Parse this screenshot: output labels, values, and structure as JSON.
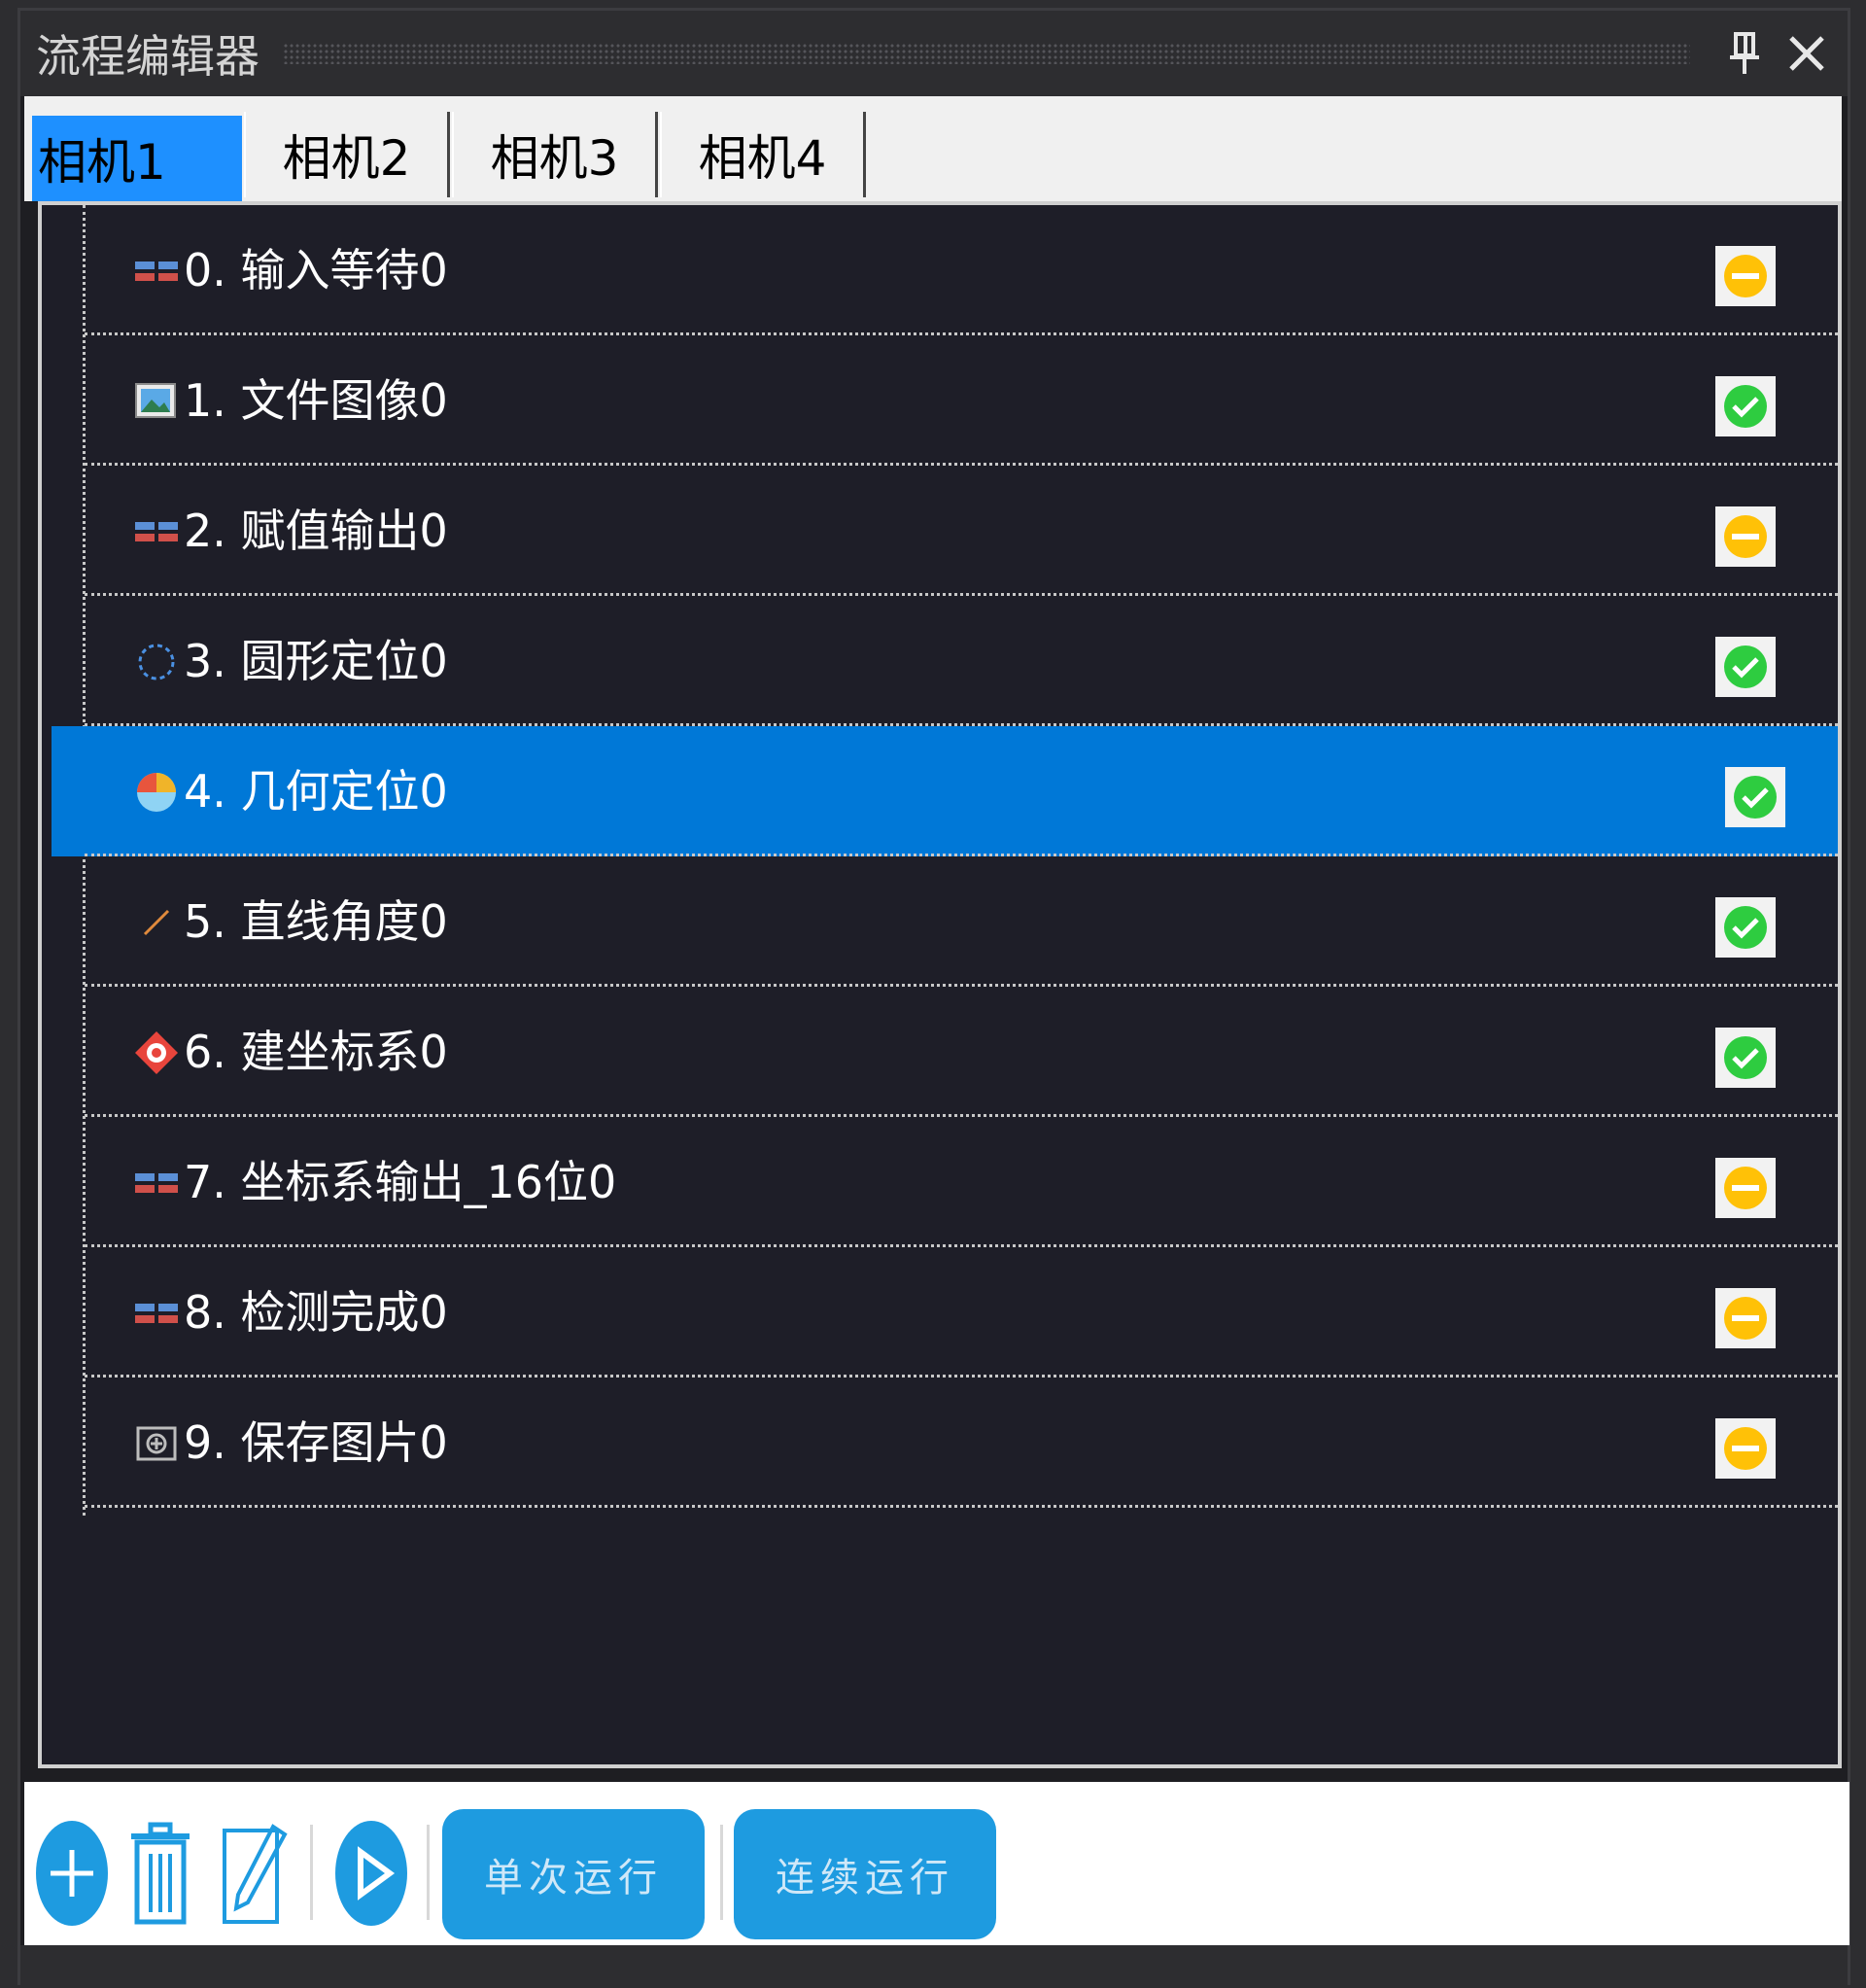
{
  "panel": {
    "title": "流程编辑器"
  },
  "tabs": [
    {
      "label": "相机1",
      "active": true
    },
    {
      "label": "相机2",
      "active": false
    },
    {
      "label": "相机3",
      "active": false
    },
    {
      "label": "相机4",
      "active": false
    }
  ],
  "steps": [
    {
      "label": "0. 输入等待0",
      "icon": "io-blocks-icon",
      "status": "pending"
    },
    {
      "label": "1. 文件图像0",
      "icon": "image-file-icon",
      "status": "ok"
    },
    {
      "label": "2. 赋值输出0",
      "icon": "io-blocks-icon",
      "status": "pending"
    },
    {
      "label": "3. 圆形定位0",
      "icon": "dashed-circle-icon",
      "status": "ok"
    },
    {
      "label": "4. 几何定位0",
      "icon": "pie-chart-icon",
      "status": "ok"
    },
    {
      "label": "5. 直线角度0",
      "icon": "line-angle-icon",
      "status": "ok"
    },
    {
      "label": "6. 建坐标系0",
      "icon": "coordinate-target-icon",
      "status": "ok"
    },
    {
      "label": "7. 坐标系输出_16位0",
      "icon": "io-blocks-icon",
      "status": "pending"
    },
    {
      "label": "8. 检测完成0",
      "icon": "io-blocks-icon",
      "status": "pending"
    },
    {
      "label": "9. 保存图片0",
      "icon": "save-image-icon",
      "status": "pending"
    }
  ],
  "selected_step": 4,
  "toolbar": {
    "single_run_label": "单次运行",
    "continuous_run_label": "连续运行"
  },
  "colors": {
    "selection": "#0078d7",
    "active_tab": "#1e90ff",
    "status_ok": "#2ecc40",
    "status_pending": "#ffc107",
    "run_button": "#1e9be0"
  }
}
